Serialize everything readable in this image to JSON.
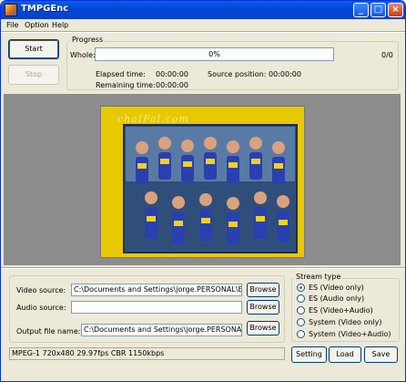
{
  "window": {
    "title": "TMPGEnc",
    "controls": {
      "minimize": "_",
      "maximize": "□",
      "close": "×"
    }
  },
  "menu": {
    "items": [
      "File",
      "Option",
      "Help"
    ]
  },
  "controls": {
    "start_label": "Start",
    "stop_label": "Stop"
  },
  "progress": {
    "group_label": "Progress",
    "whole_label": "Whole:",
    "percent_text": "0%",
    "fraction": 0,
    "count_text": "0/0",
    "elapsed_label": "Elapsed time:",
    "elapsed_value": "00:00:00",
    "remaining_label": "Remaining time:",
    "remaining_value": "00:00:00",
    "source_pos_label": "Source position:",
    "source_pos_value": "00:00:00"
  },
  "preview": {
    "watermark": "chaIFal.com",
    "icon": "preview-frame"
  },
  "files": {
    "video_label": "Video source:",
    "video_value": "C:\\Documents and Settings\\jorge.PERSONAL\\Escritor",
    "audio_label": "Audio source:",
    "audio_value": "",
    "output_label": "Output file name:",
    "output_value": "C:\\Documents and Settings\\jorge.PERSONAL\\Escri",
    "browse_label": "Browse"
  },
  "stream_type": {
    "label": "Stream type",
    "options": [
      "ES (Video only)",
      "ES (Audio only)",
      "ES (Video+Audio)",
      "System (Video only)",
      "System (Video+Audio)"
    ],
    "selected_index": 0
  },
  "status": {
    "text": "MPEG-1 720x480 29.97fps CBR 1150kbps"
  },
  "footer": {
    "setting_label": "Setting",
    "load_label": "Load",
    "save_label": "Save"
  },
  "colors": {
    "titlebar": "#0a5fe8",
    "progress_fill": "#3c8c28",
    "preview_bg": "#e8c800",
    "workspace": "#8c8c8c"
  }
}
